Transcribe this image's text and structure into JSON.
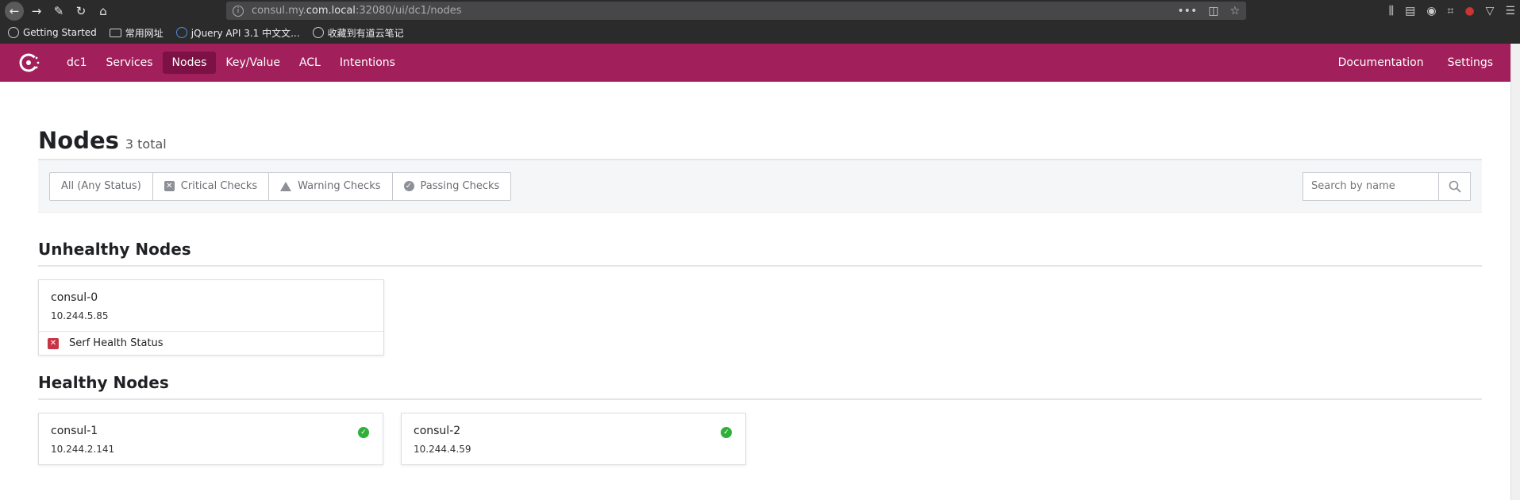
{
  "browser": {
    "url_host_prefix": "consul.my.",
    "url_host": "com.local",
    "url_rest": ":32080/ui/dc1/nodes",
    "bookmarks": [
      {
        "label": "Getting Started",
        "icon": "globe-icon"
      },
      {
        "label": "常用网址",
        "icon": "folder-icon"
      },
      {
        "label": "jQuery API 3.1 中文文...",
        "icon": "jquery-icon"
      },
      {
        "label": "收藏到有道云笔记",
        "icon": "globe-icon"
      }
    ]
  },
  "nav": {
    "datacenter": "dc1",
    "items": [
      "Services",
      "Nodes",
      "Key/Value",
      "ACL",
      "Intentions"
    ],
    "active": "Nodes",
    "right": [
      "Documentation",
      "Settings"
    ],
    "brand_color": "#a1205b"
  },
  "page": {
    "title": "Nodes",
    "total": "3 total",
    "filters": [
      "All (Any Status)",
      "Critical Checks",
      "Warning Checks",
      "Passing Checks"
    ],
    "search_placeholder": "Search by name"
  },
  "unhealthy": {
    "title": "Unhealthy Nodes",
    "nodes": [
      {
        "name": "consul-0",
        "ip": "10.244.5.85",
        "check": "Serf Health Status"
      }
    ]
  },
  "healthy": {
    "title": "Healthy Nodes",
    "nodes": [
      {
        "name": "consul-1",
        "ip": "10.244.2.141"
      },
      {
        "name": "consul-2",
        "ip": "10.244.4.59"
      }
    ]
  },
  "colors": {
    "critical": "#c73445",
    "passing": "#2eb039"
  }
}
